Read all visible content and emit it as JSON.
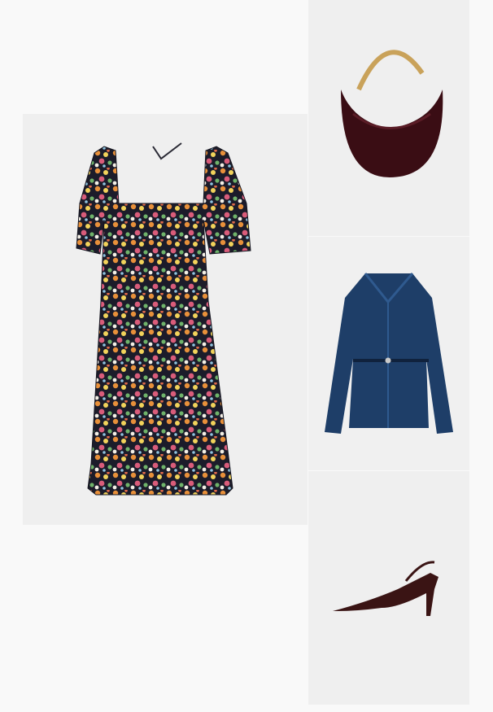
{
  "outfit": {
    "items": [
      {
        "name": "floral-maxi-dress",
        "colors": [
          "#1f1f2e",
          "#e8903a",
          "#d95c7a",
          "#f2d35b",
          "#6fb36a",
          "#f4f0e6"
        ]
      },
      {
        "name": "burgundy-hobo-bag",
        "colors": [
          "#3a0d14",
          "#c9a25a"
        ]
      },
      {
        "name": "belted-denim-jacket",
        "colors": [
          "#1e3e68",
          "#2f5a8f"
        ]
      },
      {
        "name": "slingback-pump",
        "colors": [
          "#3a1414"
        ]
      }
    ]
  }
}
